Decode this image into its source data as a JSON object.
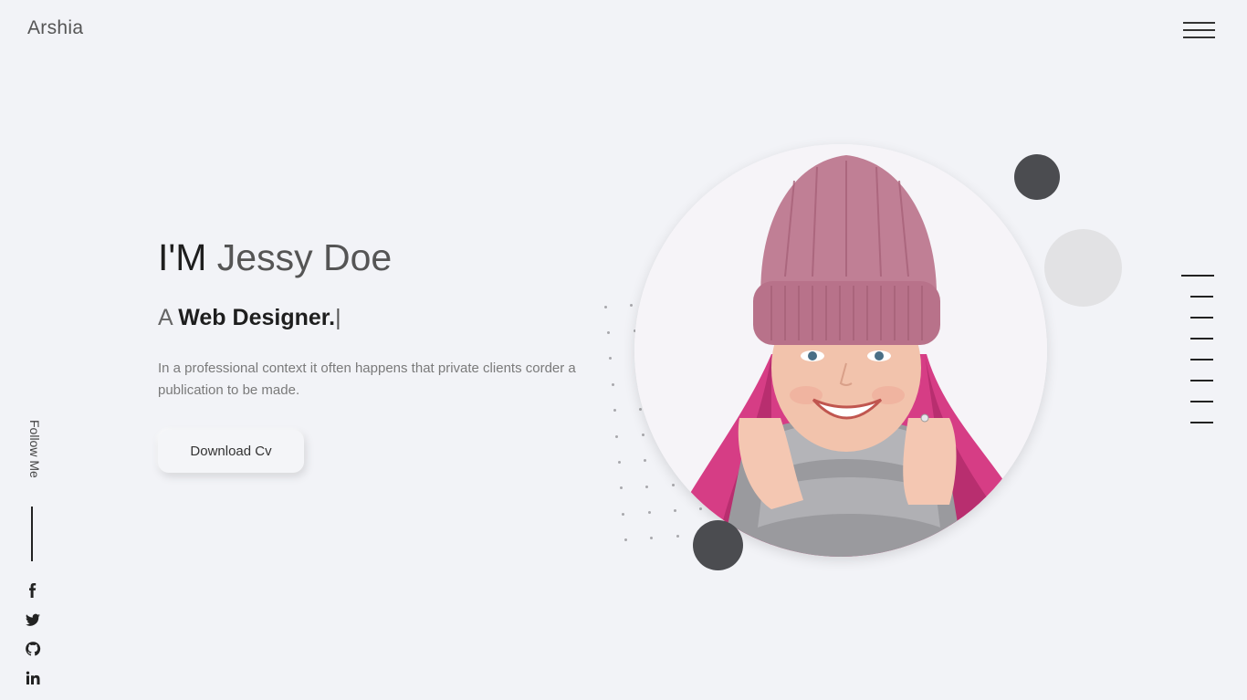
{
  "header": {
    "logo": "Arshia",
    "menu_icon": "hamburger-menu-icon"
  },
  "hero": {
    "greeting_prefix": "I'M",
    "name": "Jessy Doe",
    "subtitle_prefix": "A",
    "role": "Web Designer.",
    "typing_cursor": "|",
    "description": "In a professional context it often happens that private clients corder a publication to be made.",
    "cta_label": "Download Cv"
  },
  "social": {
    "label": "Follow Me",
    "links": [
      {
        "icon": "facebook-icon"
      },
      {
        "icon": "twitter-icon"
      },
      {
        "icon": "github-icon"
      },
      {
        "icon": "linkedin-icon"
      }
    ]
  },
  "side_nav": {
    "item_count": 8,
    "active_index": 0
  },
  "colors": {
    "background": "#f2f3f7",
    "dark_circle": "#4b4c50",
    "light_circle": "#e2e2e4",
    "text_dark": "#1e1e1e",
    "text_muted": "#7a7a7a"
  }
}
